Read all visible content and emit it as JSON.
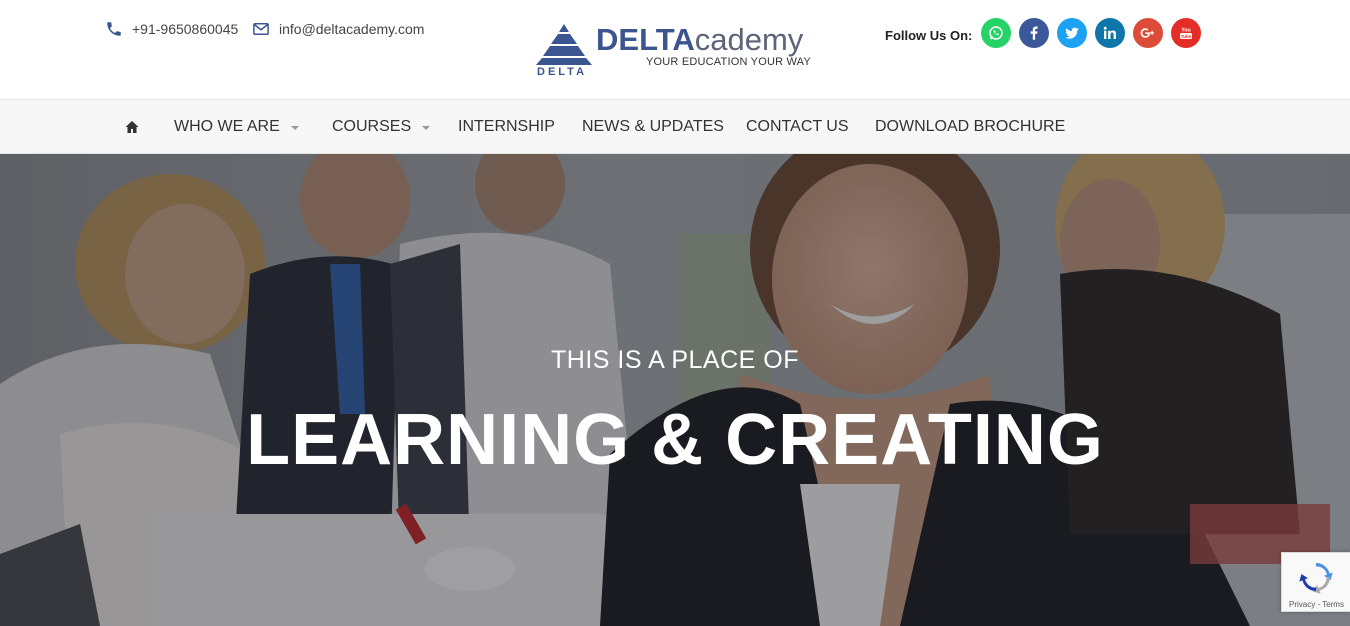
{
  "header": {
    "phone": "+91-9650860045",
    "email": "info@deltacademy.com",
    "logo": {
      "mark_text": "DELTA",
      "brand_bold": "DELTA",
      "brand_light": "cademy",
      "tagline": "YOUR EDUCATION YOUR WAY"
    },
    "follow_label": "Follow Us On:",
    "socials": [
      {
        "name": "whatsapp-icon",
        "color": "#25d366"
      },
      {
        "name": "facebook-icon",
        "color": "#3b5998"
      },
      {
        "name": "twitter-icon",
        "color": "#1da1f2"
      },
      {
        "name": "linkedin-icon",
        "color": "#0e76a8"
      },
      {
        "name": "google-plus-icon",
        "color": "#dd4b39"
      },
      {
        "name": "youtube-icon",
        "color": "#e52d27"
      }
    ]
  },
  "nav": {
    "home_icon": "home-icon",
    "items": [
      {
        "label": "WHO WE ARE",
        "dropdown": true
      },
      {
        "label": "COURSES",
        "dropdown": true
      },
      {
        "label": "INTERNSHIP",
        "dropdown": false
      },
      {
        "label": "NEWS & UPDATES",
        "dropdown": false
      },
      {
        "label": "CONTACT US",
        "dropdown": false
      },
      {
        "label": "DOWNLOAD BROCHURE",
        "dropdown": false
      }
    ]
  },
  "hero": {
    "subtitle": "THIS IS A PLACE OF",
    "title": "LEARNING & CREATING"
  },
  "recaptcha": {
    "links": "Privacy - Terms"
  }
}
